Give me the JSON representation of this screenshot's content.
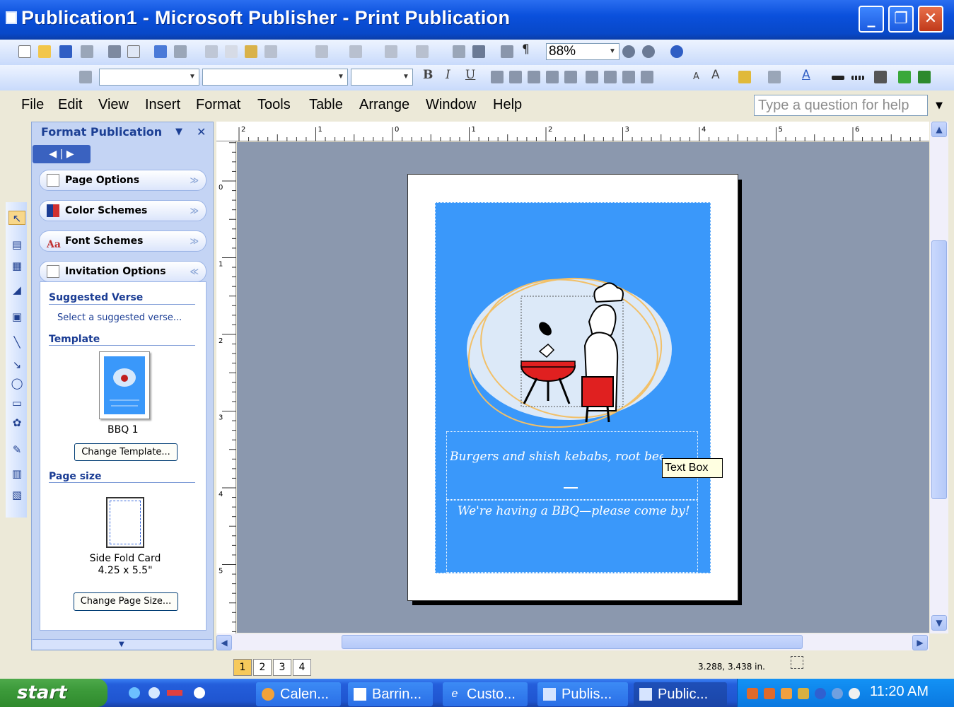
{
  "window": {
    "title": "Publication1 - Microsoft Publisher - Print Publication",
    "min_glyph": "_",
    "max_glyph": "❐",
    "close_glyph": "✕"
  },
  "standard_toolbar": {
    "zoom": "88%",
    "pilcrow": "¶"
  },
  "format_toolbar": {
    "style_value": "",
    "font_value": "",
    "size_value": "",
    "bold": "B",
    "italic": "I",
    "underline": "U",
    "font_size_down": "A",
    "font_size_up": "A",
    "font_color": "A"
  },
  "menu": {
    "items": [
      "File",
      "Edit",
      "View",
      "Insert",
      "Format",
      "Tools",
      "Table",
      "Arrange",
      "Window",
      "Help"
    ],
    "help_placeholder": "Type a question for help"
  },
  "task_pane": {
    "title": "Format Publication",
    "sections": [
      {
        "label": "Page Options",
        "chev": "≫"
      },
      {
        "label": "Color Schemes",
        "chev": "≫"
      },
      {
        "label": "Font Schemes",
        "chev": "≫"
      },
      {
        "label": "Invitation Options",
        "chev": "≪"
      }
    ],
    "suggested_verse_heading": "Suggested Verse",
    "suggested_verse_link": "Select a suggested verse...",
    "template_heading": "Template",
    "template_name": "BBQ 1",
    "change_template_button": "Change Template...",
    "page_size_heading": "Page size",
    "page_size_name": "Side Fold Card",
    "page_size_dims": "4.25 x 5.5\"",
    "change_page_size_button": "Change Page Size..."
  },
  "rulers": {
    "horizontal_labels": [
      "2",
      "1",
      "0",
      "1",
      "2",
      "3",
      "4",
      "5",
      "6"
    ],
    "vertical_labels": [
      "0",
      "1",
      "2",
      "3",
      "4",
      "5"
    ]
  },
  "document": {
    "verse_text": "Burgers and shish kebabs, root beer and pie",
    "message_text": "We're having a BBQ—please come by!",
    "tooltip": "Text Box"
  },
  "status": {
    "pages": [
      "1",
      "2",
      "3",
      "4"
    ],
    "active_page": "1",
    "coordinates": "3.288, 3.438 in."
  },
  "taskbar": {
    "start_label": "start",
    "tasks": [
      "Calen...",
      "Barrin...",
      "Custo...",
      "Publis...",
      "Public..."
    ],
    "clock": "11:20 AM"
  },
  "colors": {
    "title_bar": "#0a50dc",
    "card_blue": "#3a98fa",
    "workspace": "#8b98ae",
    "taskbar": "#245edb",
    "start_green": "#3c9a3a"
  }
}
